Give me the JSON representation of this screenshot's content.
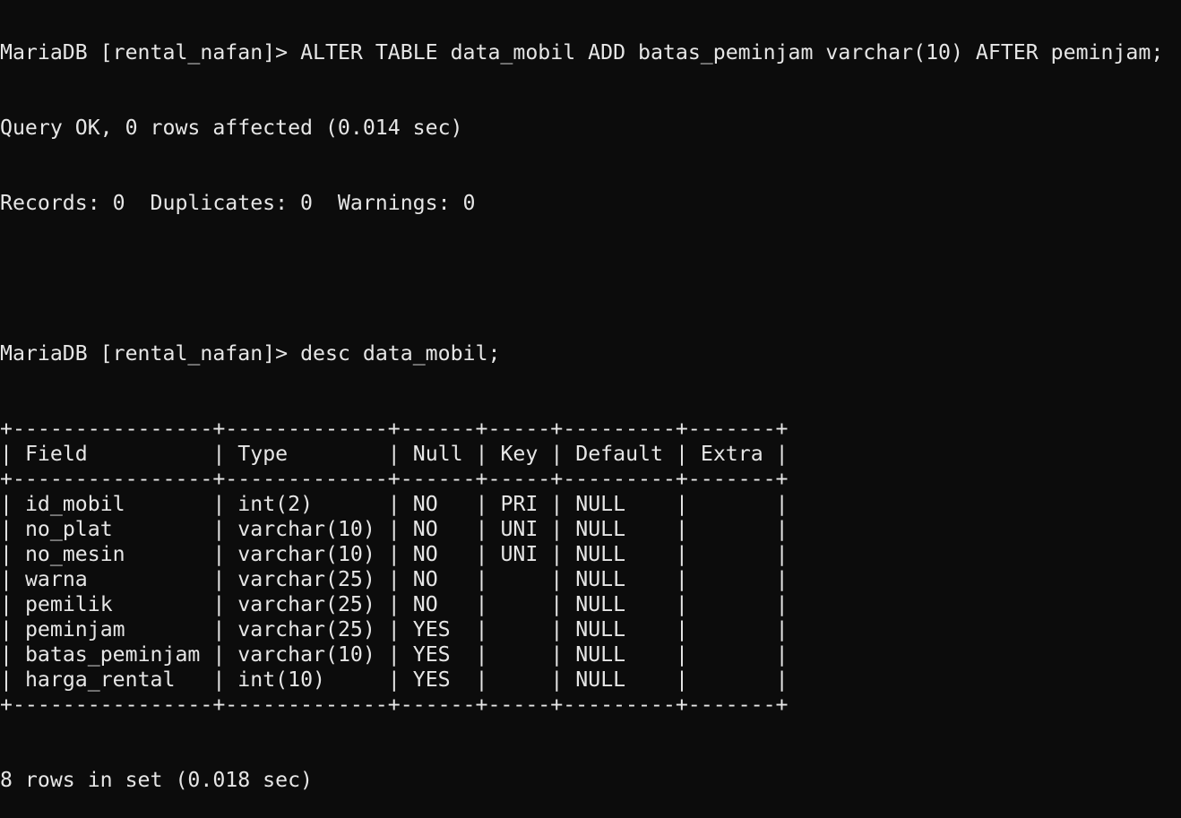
{
  "session": {
    "prompt": "MariaDB [rental_nafan]>",
    "alter_command": "ALTER TABLE data_mobil ADD batas_peminjam varchar(10) AFTER peminjam;",
    "alter_result": "Query OK, 0 rows affected (0.014 sec)",
    "alter_records": "Records: 0  Duplicates: 0  Warnings: 0",
    "desc_command": "desc data_mobil;",
    "desc_result": "8 rows in set (0.018 sec)"
  },
  "table": {
    "columns": [
      "Field",
      "Type",
      "Null",
      "Key",
      "Default",
      "Extra"
    ],
    "rows": [
      [
        "id_mobil",
        "int(2)",
        "NO",
        "PRI",
        "NULL",
        ""
      ],
      [
        "no_plat",
        "varchar(10)",
        "NO",
        "UNI",
        "NULL",
        ""
      ],
      [
        "no_mesin",
        "varchar(10)",
        "NO",
        "UNI",
        "NULL",
        ""
      ],
      [
        "warna",
        "varchar(25)",
        "NO",
        "",
        "NULL",
        ""
      ],
      [
        "pemilik",
        "varchar(25)",
        "NO",
        "",
        "NULL",
        ""
      ],
      [
        "peminjam",
        "varchar(25)",
        "YES",
        "",
        "NULL",
        ""
      ],
      [
        "batas_peminjam",
        "varchar(10)",
        "YES",
        "",
        "NULL",
        ""
      ],
      [
        "harga_rental",
        "int(10)",
        "YES",
        "",
        "NULL",
        ""
      ]
    ]
  }
}
